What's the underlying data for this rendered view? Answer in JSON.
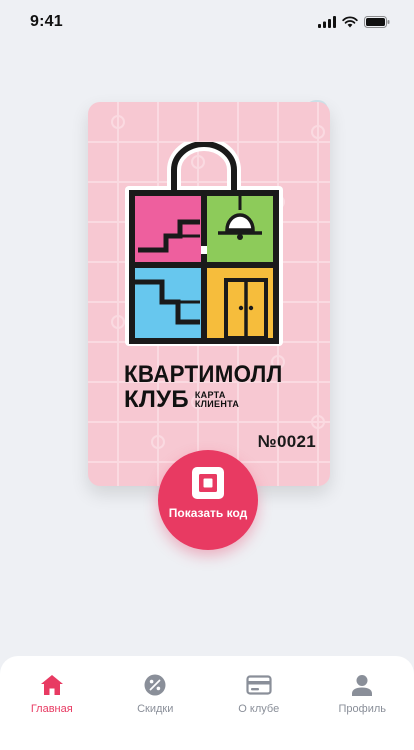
{
  "status": {
    "time": "9:41"
  },
  "card": {
    "brand_line1": "КВАРТИМОЛЛ",
    "brand_line2": "КЛУБ",
    "subtitle_line1": "КАРТА",
    "subtitle_line2": "КЛИЕНТА",
    "number": "№0021"
  },
  "actions": {
    "show_code_label": "Показать код"
  },
  "tabbar": {
    "items": [
      {
        "label": "Главная",
        "icon": "home-icon",
        "active": true
      },
      {
        "label": "Скидки",
        "icon": "percent-icon",
        "active": false
      },
      {
        "label": "О клубе",
        "icon": "card-icon",
        "active": false
      },
      {
        "label": "Профиль",
        "icon": "user-icon",
        "active": false
      }
    ]
  },
  "colors": {
    "accent": "#e83a62",
    "card_bg": "#f7c8d2",
    "inactive": "#8a8f99",
    "page_bg": "#eef0f4"
  }
}
